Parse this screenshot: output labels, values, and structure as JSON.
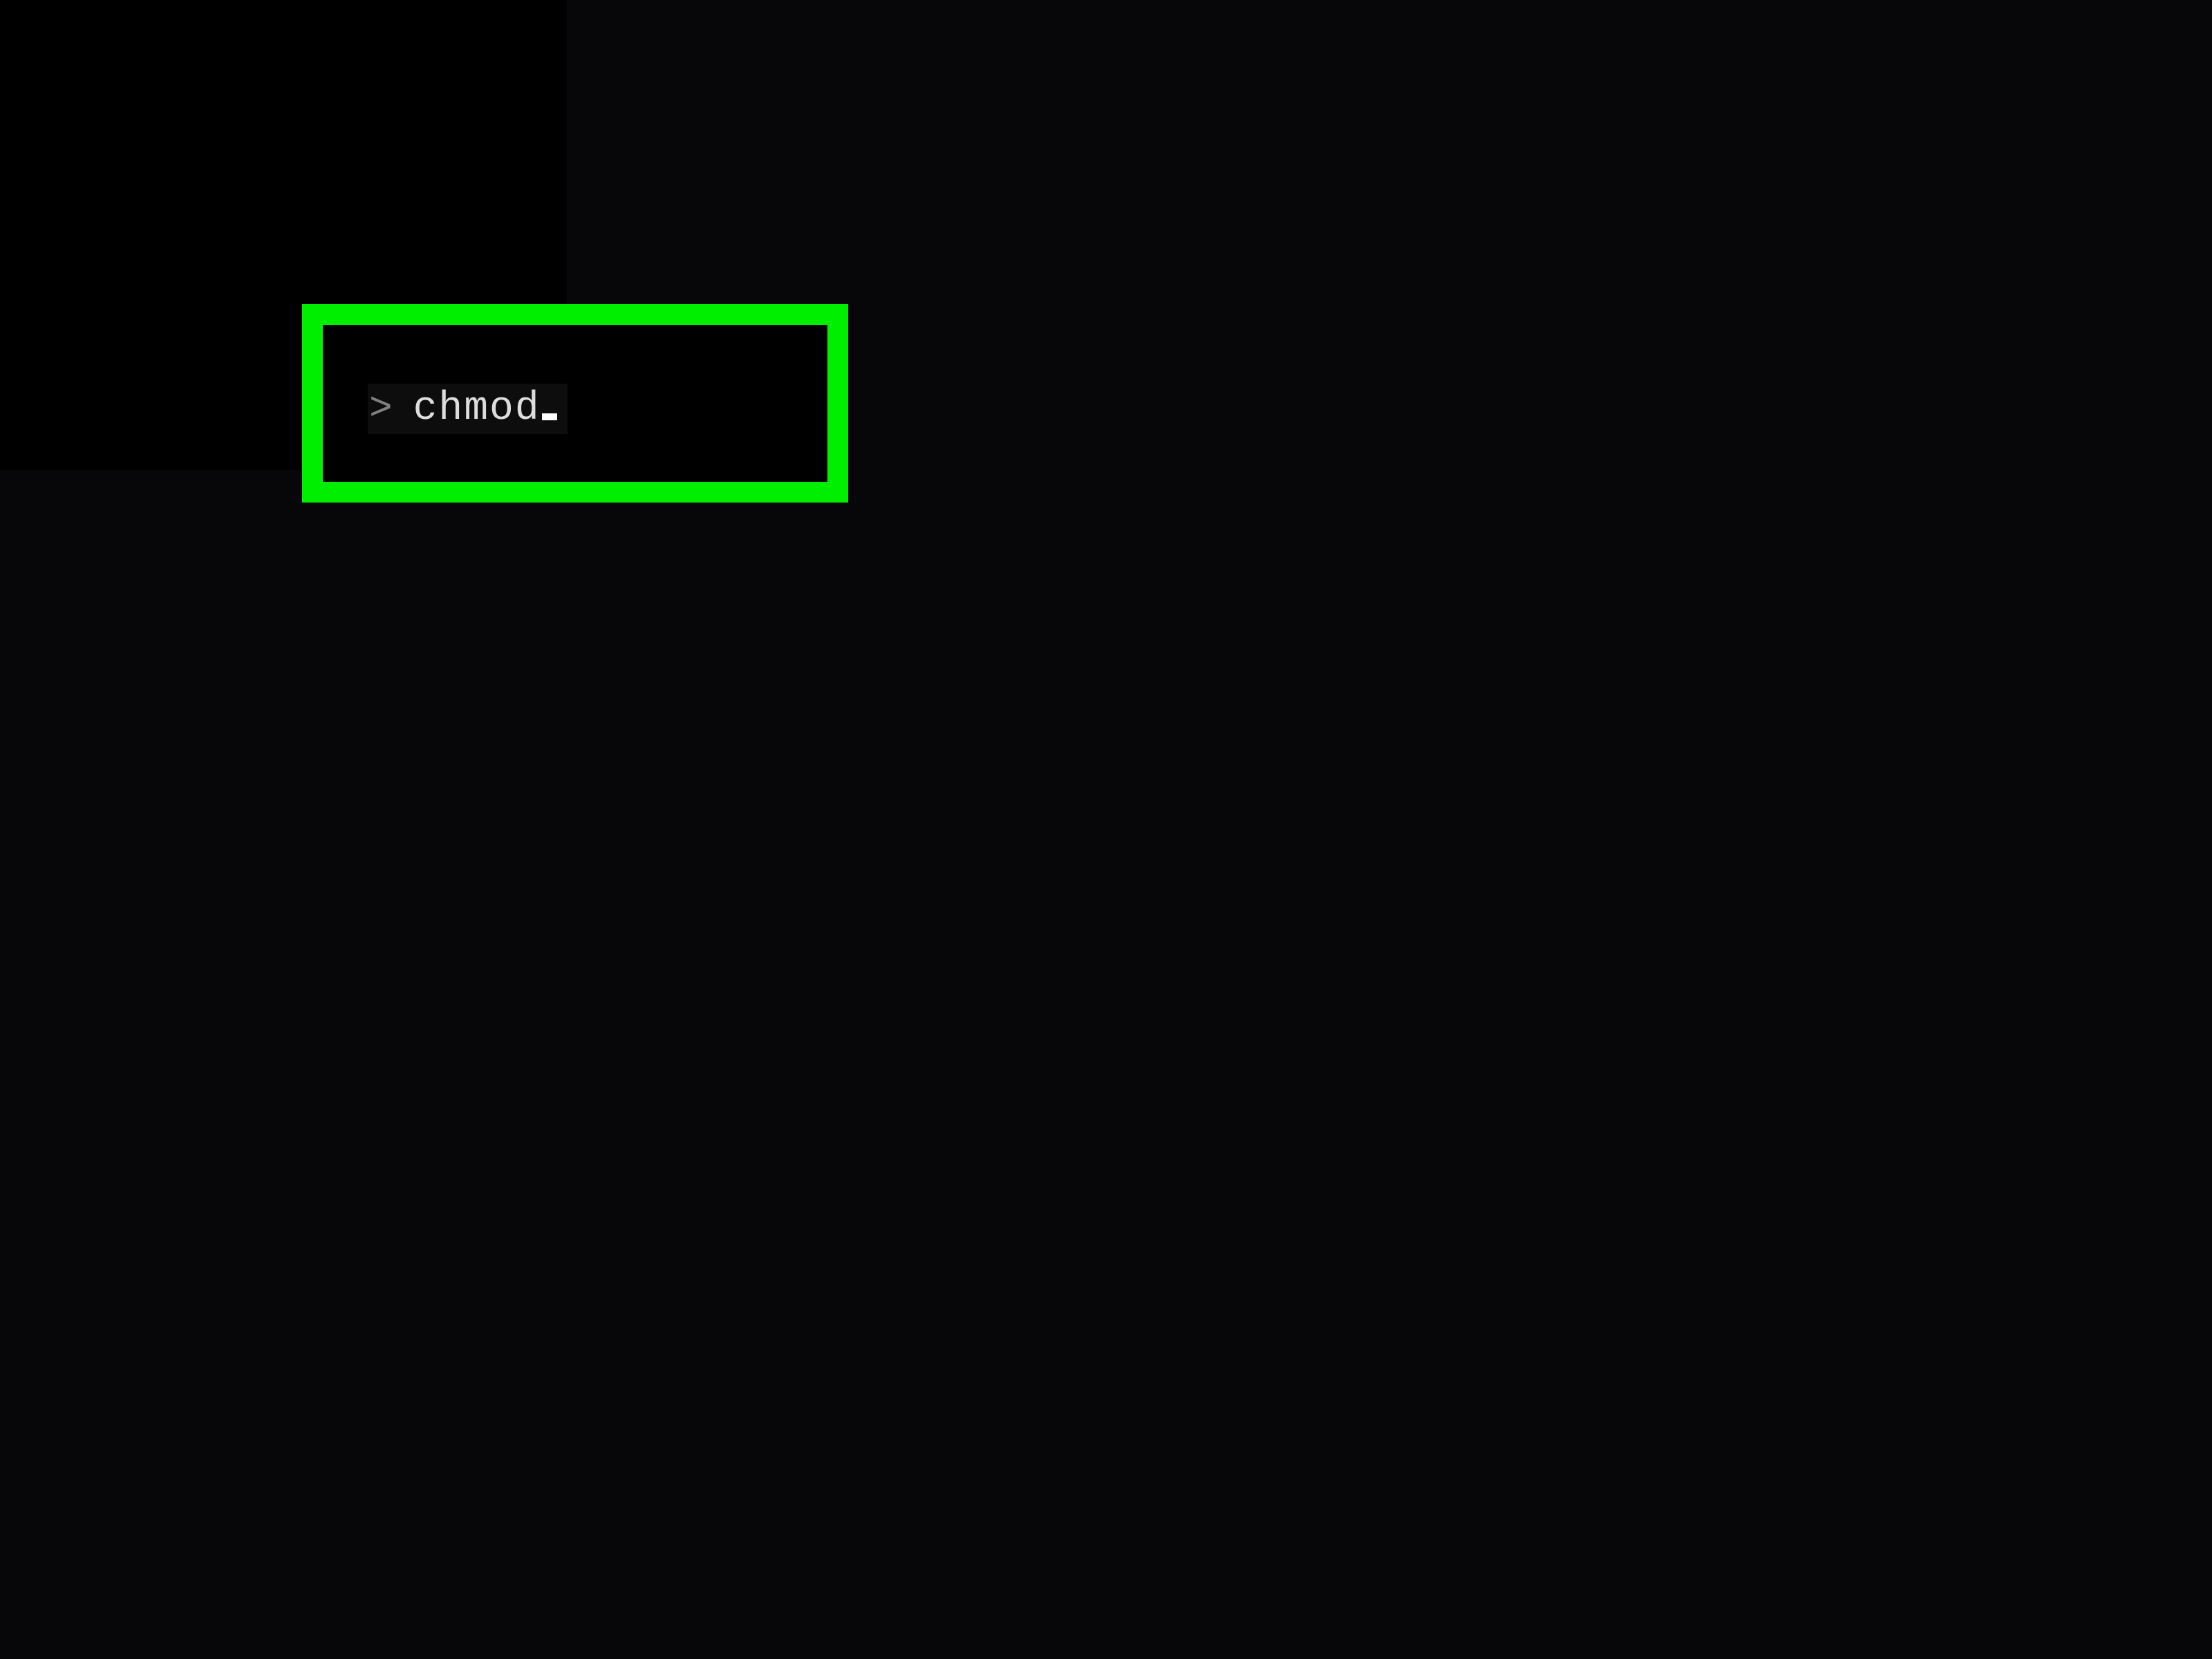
{
  "terminal": {
    "prompt": ">",
    "command": "chmod"
  },
  "colors": {
    "highlight_border": "#00EE00",
    "background": "#070709",
    "panel": "#000000"
  }
}
